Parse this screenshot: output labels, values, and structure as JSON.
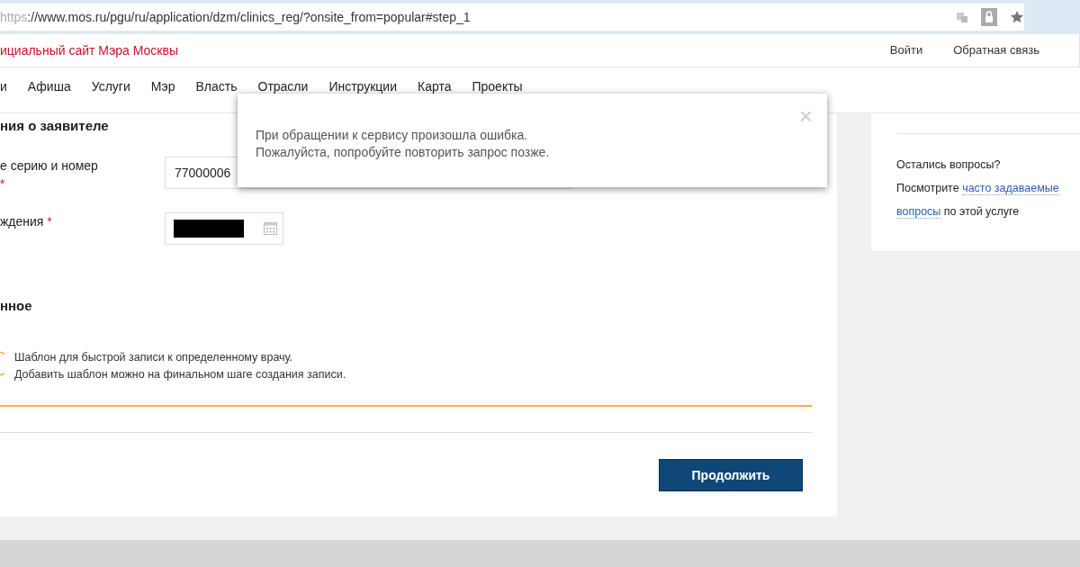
{
  "address_bar": {
    "scheme": "https",
    "rest": "://www.mos.ru/pgu/ru/application/dzm/clinics_reg/?onsite_from=popular#step_1"
  },
  "site_header": {
    "title": "ициальный сайт Мэра Москвы",
    "links": [
      "Войти",
      "Обратная связь"
    ]
  },
  "nav": {
    "items": [
      "и",
      "Афиша",
      "Услуги",
      "Мэр",
      "Власть",
      "Отрасли",
      "Инструкции",
      "Карта",
      "Проекты"
    ]
  },
  "form": {
    "section_title": "ния о заявителе",
    "fields": [
      {
        "kind": "text",
        "label": "е серию и номер",
        "required": true,
        "required_mark": "*",
        "value": "77000006"
      },
      {
        "kind": "date",
        "label": "ждения",
        "required": true,
        "required_mark": "*"
      }
    ],
    "extra_title": "нное",
    "info_lines": [
      "Шаблон для быстрой записи к определенному врачу.",
      "Добавить шаблон можно на финальном шаге создания записи."
    ],
    "submit": "Продолжить"
  },
  "sidebar": {
    "question": "Остались вопросы?",
    "before": "Посмотрите",
    "link_lines": [
      "часто задаваемые",
      "вопросы"
    ],
    "after": "по этой услуге"
  },
  "modal": {
    "lines": [
      "При обращении к сервису произошла ошибка.",
      "Пожалуйста, попробуйте повторить запрос позже."
    ],
    "close": "×"
  }
}
